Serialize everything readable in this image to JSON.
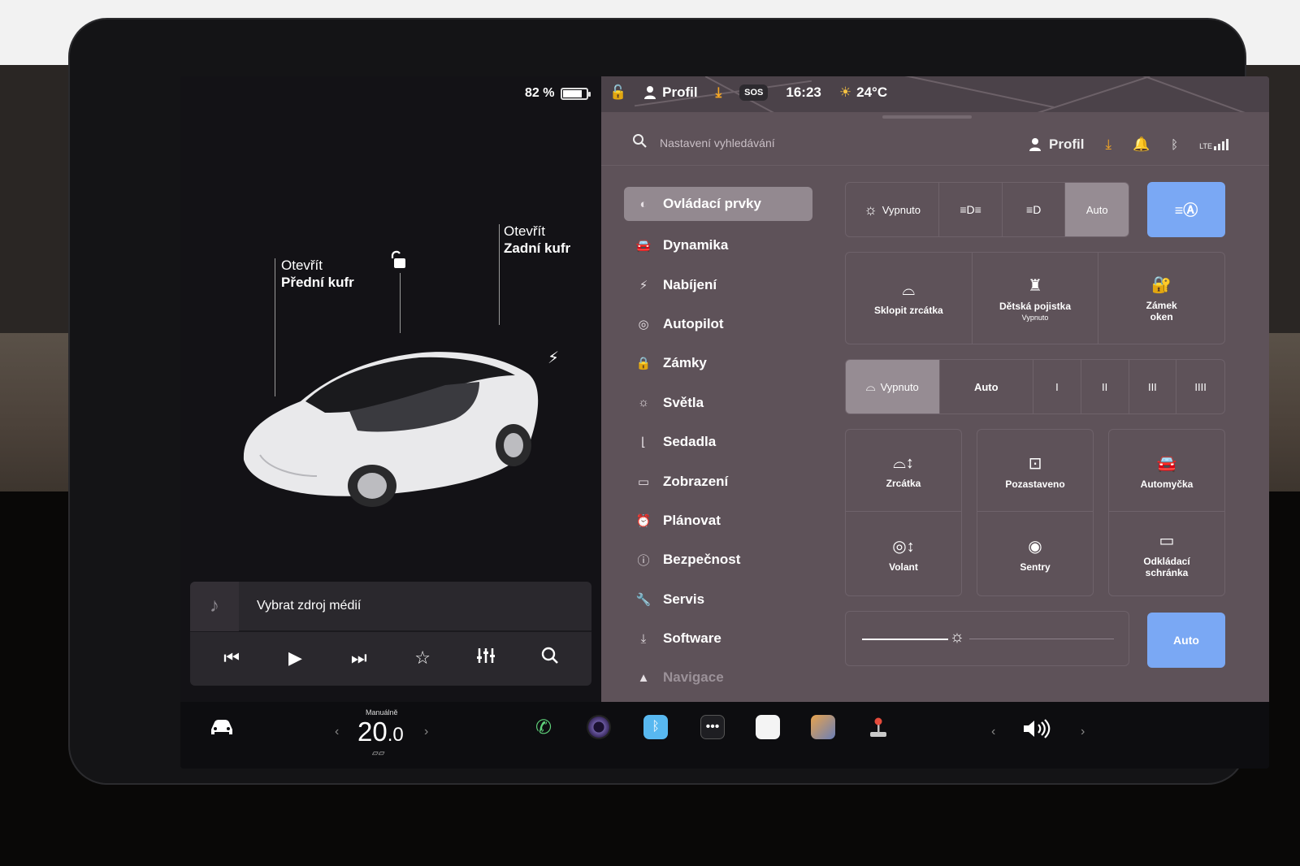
{
  "left": {
    "battery": {
      "percent_label": "82 %",
      "level": 0.82
    },
    "frunk": {
      "action": "Otevřít",
      "name": "Přední kufr"
    },
    "trunk": {
      "action": "Otevřít",
      "name": "Zadní kufr"
    },
    "icons": {
      "lock": "unlock-icon",
      "charge": "charge-bolt-icon"
    }
  },
  "media": {
    "source_label": "Vybrat zdroj médií",
    "controls": [
      "previous-track",
      "play",
      "next-track",
      "favorite",
      "equalizer",
      "search"
    ]
  },
  "status": {
    "profile": "Profil",
    "sos": "SOS",
    "time": "16:23",
    "temperature": "24°C"
  },
  "search": {
    "placeholder": "Nastavení vyhledávání"
  },
  "header_profile": "Profil",
  "menu": [
    {
      "label": "Ovládací prvky",
      "icon": "toggle-icon",
      "active": true
    },
    {
      "label": "Dynamika",
      "icon": "car-icon"
    },
    {
      "label": "Nabíjení",
      "icon": "bolt-icon"
    },
    {
      "label": "Autopilot",
      "icon": "steering-wheel-icon"
    },
    {
      "label": "Zámky",
      "icon": "lock-icon"
    },
    {
      "label": "Světla",
      "icon": "sun-icon"
    },
    {
      "label": "Sedadla",
      "icon": "seat-icon"
    },
    {
      "label": "Zobrazení",
      "icon": "display-icon"
    },
    {
      "label": "Plánovat",
      "icon": "alarm-icon"
    },
    {
      "label": "Bezpečnost",
      "icon": "alert-icon"
    },
    {
      "label": "Servis",
      "icon": "wrench-icon"
    },
    {
      "label": "Software",
      "icon": "download-icon"
    },
    {
      "label": "Navigace",
      "icon": "navigation-icon"
    }
  ],
  "lights": {
    "off_label": "Vypnuto",
    "auto_label": "Auto",
    "active": "Auto"
  },
  "quick_tiles": [
    {
      "label": "Sklopit zrcátka",
      "sub": "",
      "icon": "mirror-fold-icon"
    },
    {
      "label": "Dětská pojistka",
      "sub": "Vypnuto",
      "icon": "child-lock-icon"
    },
    {
      "label": "Zámek",
      "label2": "oken",
      "sub": "",
      "icon": "window-lock-icon"
    }
  ],
  "wipers": {
    "off_label": "Vypnuto",
    "auto_label": "Auto",
    "speeds": [
      "I",
      "II",
      "III",
      "IIII"
    ],
    "active": "Vypnuto"
  },
  "cards": [
    {
      "top": {
        "label": "Zrcátka",
        "icon": "mirror-adjust-icon"
      },
      "bottom": {
        "label": "Volant",
        "icon": "steering-adjust-icon"
      }
    },
    {
      "top": {
        "label": "Pozastaveno",
        "icon": "dashcam-icon"
      },
      "bottom": {
        "label": "Sentry",
        "icon": "sentry-icon"
      }
    },
    {
      "top": {
        "label": "Automyčka",
        "icon": "car-wash-icon"
      },
      "bottom": {
        "label": "Odkládací",
        "label2": "schránka",
        "icon": "glovebox-icon"
      }
    }
  ],
  "brightness": {
    "level": 0.38,
    "auto_label": "Auto"
  },
  "dock": {
    "climate_mode": "Manuálně",
    "temperature_int": "20",
    "temperature_dec": ".0",
    "apps": [
      "phone-icon",
      "camera-icon",
      "bluetooth-icon",
      "more-icon",
      "notes-icon",
      "toybox-icon",
      "joystick-icon"
    ],
    "volume_icon": "volume-icon"
  }
}
